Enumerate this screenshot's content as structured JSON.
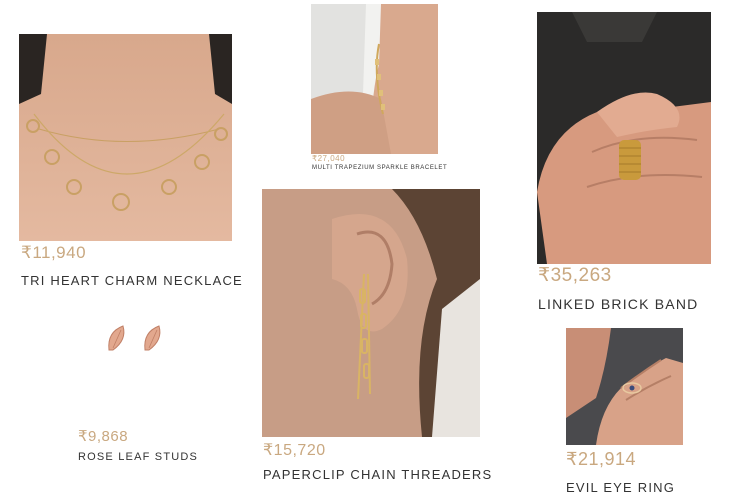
{
  "products": [
    {
      "id": "necklace",
      "price": "₹11,940",
      "name": "TRI HEART CHARM NECKLACE"
    },
    {
      "id": "bracelet",
      "price": "₹27,040",
      "name": "MULTI TRAPEZIUM SPARKLE BRACELET"
    },
    {
      "id": "band",
      "price": "₹35,263",
      "name": "LINKED BRICK BAND"
    },
    {
      "id": "studs",
      "price": "₹9,868",
      "name": "ROSE LEAF STUDS"
    },
    {
      "id": "threaders",
      "price": "₹15,720",
      "name": "PAPERCLIP CHAIN THREADERS"
    },
    {
      "id": "ring",
      "price": "₹21,914",
      "name": "EVIL EYE RING"
    }
  ],
  "colors": {
    "price": "#c9a880",
    "name": "#333333",
    "gold": "#d8b56a"
  }
}
